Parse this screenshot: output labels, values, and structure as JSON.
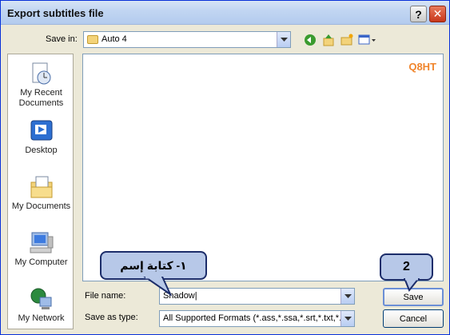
{
  "window": {
    "title": "Export subtitles file"
  },
  "titlebar": {
    "help_symbol": "?",
    "close_symbol": "✕"
  },
  "save_in": {
    "label": "Save in:",
    "value": "Auto 4"
  },
  "toolbar_icons": [
    "back-icon",
    "up-folder-icon",
    "new-folder-icon",
    "views-menu-icon"
  ],
  "places": [
    {
      "label": "My Recent Documents",
      "icon": "recent-documents-icon"
    },
    {
      "label": "Desktop",
      "icon": "desktop-icon"
    },
    {
      "label": "My Documents",
      "icon": "my-documents-icon"
    },
    {
      "label": "My Computer",
      "icon": "my-computer-icon"
    },
    {
      "label": "My Network",
      "icon": "my-network-icon"
    }
  ],
  "filelist": {
    "watermark": "Q8HT"
  },
  "file_name": {
    "label": "File name:",
    "value": "Shadow|"
  },
  "save_as_type": {
    "label": "Save as type:",
    "value": "All Supported Formats (*.ass,*.ssa,*.srt,*.txt,*.ttxt"
  },
  "buttons": {
    "save": "Save",
    "cancel": "Cancel"
  },
  "callouts": {
    "step1": "١- كتابة إسم",
    "step2": "2"
  },
  "colors": {
    "accent": "#0831d9",
    "callout_fill": "#b7c8e8",
    "watermark": "#f0852c",
    "close": "#c8371a"
  }
}
